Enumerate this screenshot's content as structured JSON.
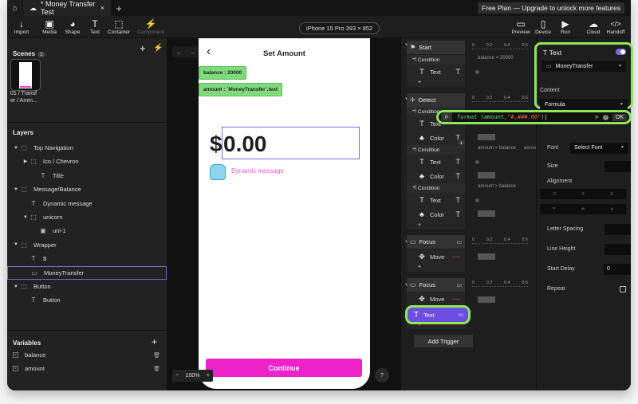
{
  "tabbar": {
    "home_icon": "home-icon",
    "tab_title": "* Money Transfer Test",
    "tab_icon": "cloud-icon",
    "close": "×",
    "new_tab": "+",
    "plan_banner": "Free Plan — Upgrade to unlock more features"
  },
  "toolbar": {
    "tools": [
      {
        "label": "Import",
        "icon": "↓"
      },
      {
        "label": "Media",
        "icon": "▣"
      },
      {
        "label": "Shape",
        "icon": "◕"
      },
      {
        "label": "Text",
        "icon": "T"
      },
      {
        "label": "Container",
        "icon": "⬚"
      },
      {
        "label": "Component",
        "icon": "⚡"
      }
    ],
    "device": "iPhone 15 Pro  393 × 852",
    "right_tools": [
      {
        "label": "Preview",
        "icon": "▭"
      },
      {
        "label": "Device",
        "icon": "▯"
      },
      {
        "label": "Run",
        "icon": "▶"
      },
      {
        "label": "Cloud",
        "icon": "☁"
      },
      {
        "label": "Handoff",
        "icon": "</>"
      }
    ]
  },
  "scenes": {
    "title": "Scenes",
    "count": "1",
    "add": "+",
    "bolt": "⚡",
    "items": [
      {
        "label": "01 / Transf er / Amm..."
      }
    ]
  },
  "layers": {
    "title": "Layers",
    "items": [
      {
        "label": "Top Navigation",
        "icon": "⬚",
        "expand": "▼"
      },
      {
        "label": "Ico / Chevron",
        "icon": "⬚",
        "expand": "▶"
      },
      {
        "label": "Title",
        "icon": "T",
        "expand": ""
      },
      {
        "label": "Message/Balance",
        "icon": "⬚",
        "expand": "▼"
      },
      {
        "label": "Dynamic message",
        "icon": "T",
        "expand": ""
      },
      {
        "label": "unicorn",
        "icon": "⬚",
        "expand": "▼"
      },
      {
        "label": "uni-1",
        "icon": "▣",
        "expand": ""
      },
      {
        "label": "Wrapper",
        "icon": "⬚",
        "expand": "▼"
      },
      {
        "label": "$",
        "icon": "T",
        "expand": ""
      },
      {
        "label": "MoneyTransfer",
        "icon": "▭",
        "expand": ""
      },
      {
        "label": "Button",
        "icon": "⬚",
        "expand": "▼"
      },
      {
        "label": "Button",
        "icon": "T",
        "expand": ""
      }
    ]
  },
  "variables": {
    "title": "Variables",
    "add": "+",
    "items": [
      {
        "name": "balance"
      },
      {
        "name": "amount"
      }
    ]
  },
  "canvas": {
    "back": "‹",
    "screen_title": "Set Amount",
    "tag_balance": "balance : 20000",
    "tag_amount": "amount : `MoneyTransfer`.text",
    "dollar": "$",
    "amount_value": "0.00",
    "dynamic_message": "Dynamic message",
    "continue": "Continue",
    "zoom_minus": "−",
    "zoom_level": "100%",
    "zoom_plus": "+",
    "help": "?"
  },
  "timeline": {
    "ruler": [
      "0",
      "0.2",
      "0.4",
      "0.6"
    ],
    "start": "Start",
    "detect": "Detect",
    "focus": "Focus",
    "condition": "Condition",
    "text": "Text",
    "color": "Color",
    "move": "Move",
    "add": "+",
    "note_start": "balance = 20000",
    "note_lt": "amount < balance",
    "note_lt2": "amount >",
    "note_gt": "amount > balance",
    "add_trigger": "Add Trigger"
  },
  "props": {
    "section": "Text",
    "toggle_on": true,
    "target": "MoneyTransfer",
    "content_label": "Content",
    "content_value": "Formula",
    "formula_fn": "format (amount, ",
    "formula_str": "\"#,###.00\"",
    "formula_close": ")",
    "formula_ok": "OK",
    "font_label": "Font",
    "font_value": "Select Font",
    "size_label": "Size",
    "alignment_label": "Alignment",
    "letter_spacing_label": "Letter Spacing",
    "line_height_label": "Line Height",
    "start_delay_label": "Start Delay",
    "start_delay_value": "0",
    "repeat_label": "Repeat"
  },
  "colors": {
    "highlight": "#8ee85a",
    "accent": "#7b6cd8",
    "button": "#ee22c9",
    "tag": "#81d97e"
  }
}
